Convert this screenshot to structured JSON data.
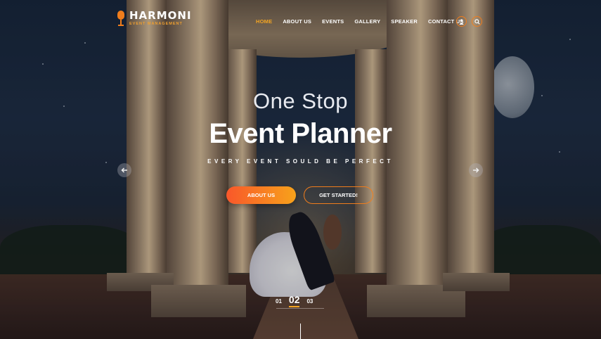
{
  "brand": {
    "name": "HARMONI",
    "tagline": "EVENT MANAGEMENT",
    "accent": "#f07d1c",
    "active_color": "#f5a623"
  },
  "nav": {
    "items": [
      {
        "label": "HOME",
        "active": true
      },
      {
        "label": "ABOUT US",
        "active": false
      },
      {
        "label": "EVENTS",
        "active": false
      },
      {
        "label": "GALLERY",
        "active": false
      },
      {
        "label": "SPEAKER",
        "active": false
      },
      {
        "label": "CONTACT US",
        "active": false
      }
    ],
    "icons": [
      "user-icon",
      "search-icon"
    ]
  },
  "hero": {
    "headline_light": "One Stop",
    "headline_bold": "Event Planner",
    "tagline": "EVERY EVENT  SOULD BE PERFECT",
    "primary_button": "ABOUT US",
    "secondary_button": "GET STARTED!",
    "prev_icon": "arrow-left-icon",
    "next_icon": "arrow-right-icon"
  },
  "slider": {
    "pages": [
      "01",
      "02",
      "03"
    ],
    "current": "02"
  }
}
